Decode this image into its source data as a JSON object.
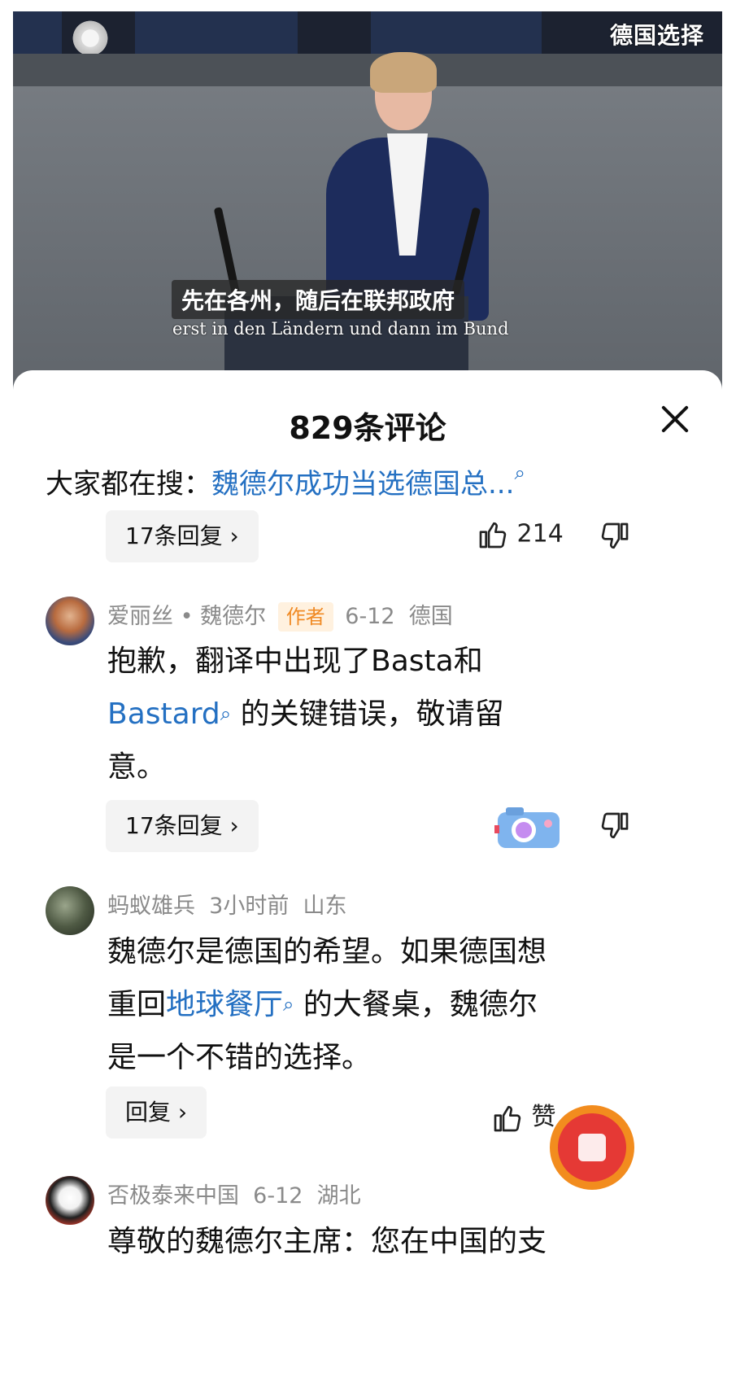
{
  "video": {
    "logo": "德国选择",
    "subtitle_cn": "先在各州，随后在联邦政府",
    "subtitle_de": "erst in den Ländern und dann im Bund"
  },
  "sheet": {
    "title": "829条评论",
    "hot_search_prefix": "大家都在搜：",
    "hot_search_link": "魏德尔成功当选德国总...",
    "search_icon": "🔍"
  },
  "top_thread": {
    "reply_label": "17条回复 ›",
    "likes": "214"
  },
  "comments": [
    {
      "author": "爱丽丝 • 魏德尔",
      "tag": "作者",
      "date": "6-12",
      "location": "德国",
      "text_a": "抱歉，翻译中出现了Basta和",
      "link": "Bastard",
      "text_b": " 的关键错误，敬请留",
      "text_c": "意。",
      "reply_label": "17条回复 ›"
    },
    {
      "author": "蚂蚁雄兵",
      "date": "3小时前",
      "location": "山东",
      "text_a": "魏德尔是德国的希望。如果德国想",
      "text_b": "重回",
      "link": "地球餐厅",
      "text_c": " 的大餐桌，魏德尔",
      "text_d": "是一个不错的选择。",
      "reply_label": "回复 ›",
      "like_label": "赞"
    },
    {
      "author": "否极泰来中国",
      "date": "6-12",
      "location": "湖北",
      "text_a": "尊敬的魏德尔主席：您在中国的支"
    }
  ],
  "icons": {
    "close": "close-icon",
    "like": "thumbs-up-icon",
    "dislike": "thumbs-down-icon",
    "search": "search-icon",
    "camera": "camera-icon",
    "red_packet": "red-packet-icon"
  }
}
